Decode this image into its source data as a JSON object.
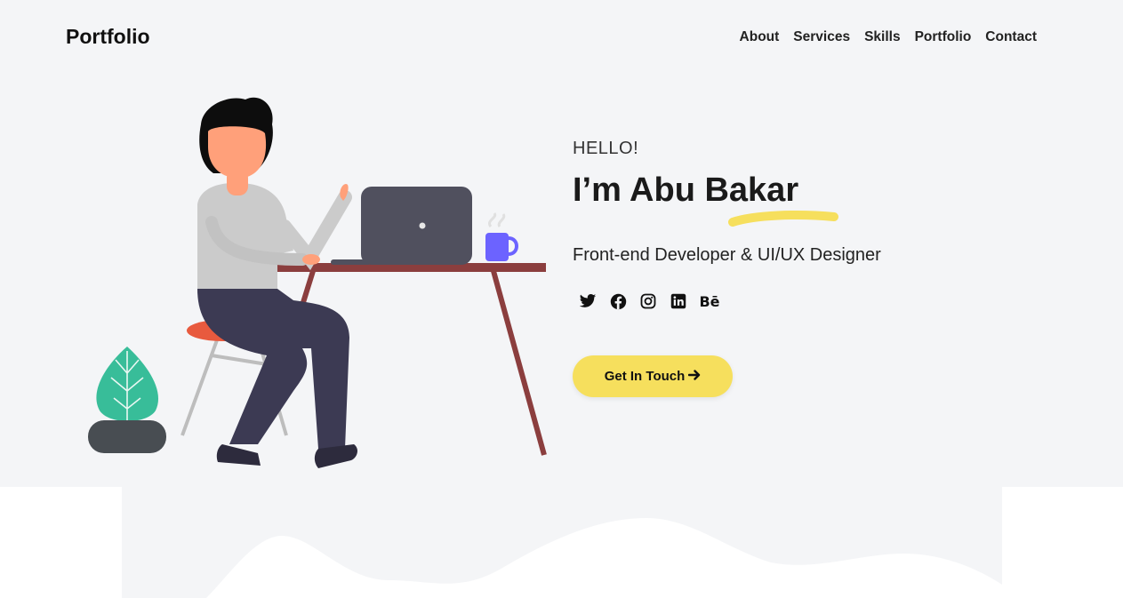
{
  "header": {
    "brand": "Portfolio",
    "nav": [
      "About",
      "Services",
      "Skills",
      "Portfolio",
      "Contact"
    ]
  },
  "hero": {
    "greeting": "HELLO!",
    "name": "I’m Abu Bakar",
    "role": "Front-end Developer & UI/UX Designer",
    "cta_label": "Get In Touch",
    "cta_icon": "arrow-right-icon",
    "social_icons": [
      "twitter-icon",
      "facebook-icon",
      "instagram-icon",
      "linkedin-icon",
      "behance-icon"
    ],
    "behance_text": "Bē"
  },
  "colors": {
    "background": "#f4f5f7",
    "accent_yellow": "#f6df5d",
    "text_dark": "#1a1a1a",
    "desk": "#8b3e3e",
    "laptop": "#50505e",
    "mug": "#6c63ff",
    "plant": "#38bd99",
    "pants": "#3c3a53",
    "stool_seat": "#e85a3e"
  }
}
